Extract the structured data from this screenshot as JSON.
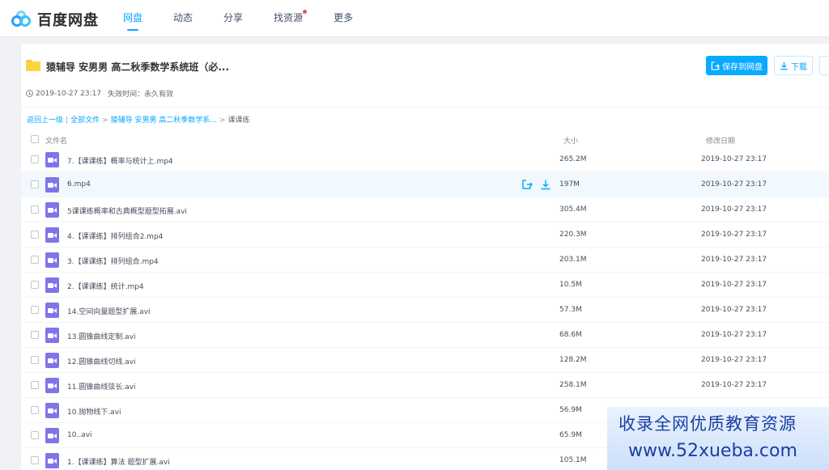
{
  "app": {
    "logo_text": "百度网盘",
    "nav": [
      {
        "label": "网盘",
        "active": true
      },
      {
        "label": "动态"
      },
      {
        "label": "分享"
      },
      {
        "label": "找资源",
        "badge": true
      },
      {
        "label": "更多"
      }
    ]
  },
  "share": {
    "title": "猿辅导 安男男 高二秋季数学系统班（必...",
    "created": "2019-10-27 23:17",
    "expire": "失效时间：永久有效",
    "save_label": "保存到网盘",
    "download_label": "下载"
  },
  "breadcrumb": {
    "back": "返回上一级",
    "all": "全部文件",
    "parent": "猿辅导 安男男 高二秋季数学系...",
    "current": "课课练"
  },
  "table": {
    "headers": {
      "name": "文件名",
      "size": "大小",
      "date": "修改日期"
    },
    "rows": [
      {
        "name": "7.【课课练】概率与统计上.mp4",
        "size": "265.2M",
        "date": "2019-10-27 23:17"
      },
      {
        "name": "6.mp4",
        "size": "197M",
        "date": "2019-10-27 23:17",
        "hover": true
      },
      {
        "name": "5课课练概率和古典概型题型拓展.avi",
        "size": "305.4M",
        "date": "2019-10-27 23:17"
      },
      {
        "name": "4.【课课练】排列组合2.mp4",
        "size": "220.3M",
        "date": "2019-10-27 23:17"
      },
      {
        "name": "3.【课课练】排列组合.mp4",
        "size": "203.1M",
        "date": "2019-10-27 23:17"
      },
      {
        "name": "2.【课课练】统计.mp4",
        "size": "10.5M",
        "date": "2019-10-27 23:17"
      },
      {
        "name": "14.空间向量题型扩展.avi",
        "size": "57.3M",
        "date": "2019-10-27 23:17"
      },
      {
        "name": "13.圆锥曲线定制.avi",
        "size": "68.6M",
        "date": "2019-10-27 23:17"
      },
      {
        "name": "12.圆锥曲线切线.avi",
        "size": "128.2M",
        "date": "2019-10-27 23:17"
      },
      {
        "name": "11.圆锥曲线弦长.avi",
        "size": "258.1M",
        "date": "2019-10-27 23:17"
      },
      {
        "name": "10.抛物线下.avi",
        "size": "56.9M",
        "date": ""
      },
      {
        "name": "10..avi",
        "size": "65.9M",
        "date": ""
      },
      {
        "name": "1.【课课练】算法 题型扩展.avi",
        "size": "105.1M",
        "date": ""
      }
    ]
  },
  "watermark": {
    "line1": "收录全网优质教育资源",
    "line2": "www.52xueba.com"
  },
  "colors": {
    "accent": "#06a7ff",
    "video_icon": "#7f75e7",
    "folder": "#fdd43c"
  }
}
